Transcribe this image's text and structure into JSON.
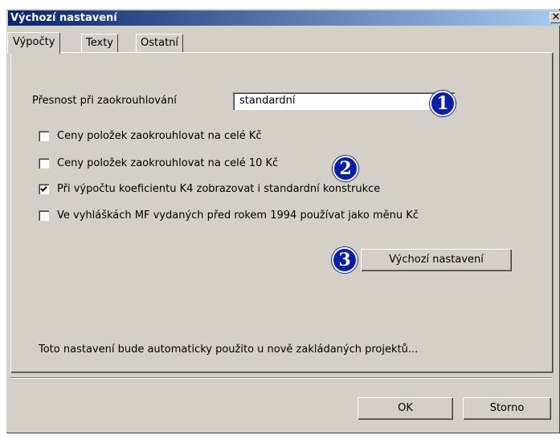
{
  "window": {
    "title": "Výchozí nastavení",
    "close_glyph": "✕"
  },
  "tabs": [
    {
      "label": "Výpočty",
      "active": true
    },
    {
      "label": "Texty",
      "active": false
    },
    {
      "label": "Ostatní",
      "active": false
    }
  ],
  "rounding": {
    "label": "Přesnost při zaokrouhlování",
    "value": "standardní"
  },
  "checkboxes": [
    {
      "label": "Ceny položek zaokrouhlovat na celé Kč",
      "checked": false
    },
    {
      "label": "Ceny položek zaokrouhlovat na celé 10 Kč",
      "checked": false
    },
    {
      "label": "Při výpočtu koeficientu K4 zobrazovat i standardní konstrukce",
      "checked": true
    },
    {
      "label": "Ve vyhláškách MF vydaných před rokem 1994 používat jako měnu Kč",
      "checked": false
    }
  ],
  "defaults_button": "Výchozí nastavení",
  "info_text": "Toto nastavení bude automaticky použito u nově zakládaných projektů...",
  "buttons": {
    "ok": "OK",
    "cancel": "Storno"
  },
  "callouts": [
    "1",
    "2",
    "3"
  ],
  "colors": {
    "title_start": "#0a246a",
    "title_end": "#a6caf0",
    "dialog_bg": "#d4d0c8",
    "callout": "#0b1fa6"
  }
}
